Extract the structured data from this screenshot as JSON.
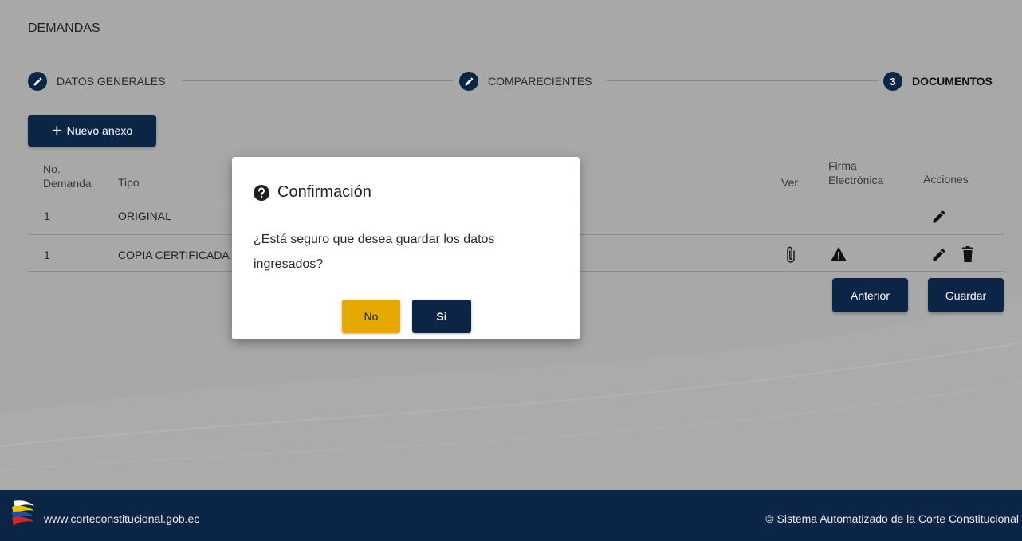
{
  "page": {
    "title": "DEMANDAS"
  },
  "stepper": {
    "steps": [
      {
        "number": "",
        "label": "DATOS GENERALES",
        "state": "done",
        "icon": "pencil-icon"
      },
      {
        "number": "",
        "label": "COMPARECIENTES",
        "state": "done",
        "icon": "pencil-icon"
      },
      {
        "number": "3",
        "label": "DOCUMENTOS",
        "state": "active"
      }
    ]
  },
  "toolbar": {
    "new_annex_label": "Nuevo anexo",
    "new_annex_icon": "plus-icon"
  },
  "table": {
    "headers": {
      "no_demanda_1": "No.",
      "no_demanda_2": "Demanda",
      "tipo": "Tipo",
      "ver": "Ver",
      "firma_1": "Firma",
      "firma_2": "Electrónica",
      "acciones": "Acciones"
    },
    "rows": [
      {
        "no": "1",
        "tipo": "ORIGINAL",
        "ver": "",
        "firma": "",
        "actions": [
          "edit-icon"
        ]
      },
      {
        "no": "1",
        "tipo": "COPIA CERTIFICADA",
        "ver": "paperclip-icon",
        "firma": "warning-icon",
        "actions": [
          "edit-icon",
          "trash-icon"
        ]
      }
    ]
  },
  "navigation": {
    "back_label": "Anterior",
    "save_label": "Guardar"
  },
  "dialog": {
    "icon": "question-circle-icon",
    "title": "Confirmación",
    "message": "¿Está seguro que desea guardar los datos ingresados?",
    "no_label": "No",
    "yes_label": "Si"
  },
  "footer": {
    "website": "www.corteconstitucional.gob.ec",
    "copyright": "© Sistema Automatizado de la Corte Constitucional"
  },
  "colors": {
    "primary": "#0b2547",
    "warning_button": "#e6a900",
    "overlay_background": "#a8a8a8"
  }
}
